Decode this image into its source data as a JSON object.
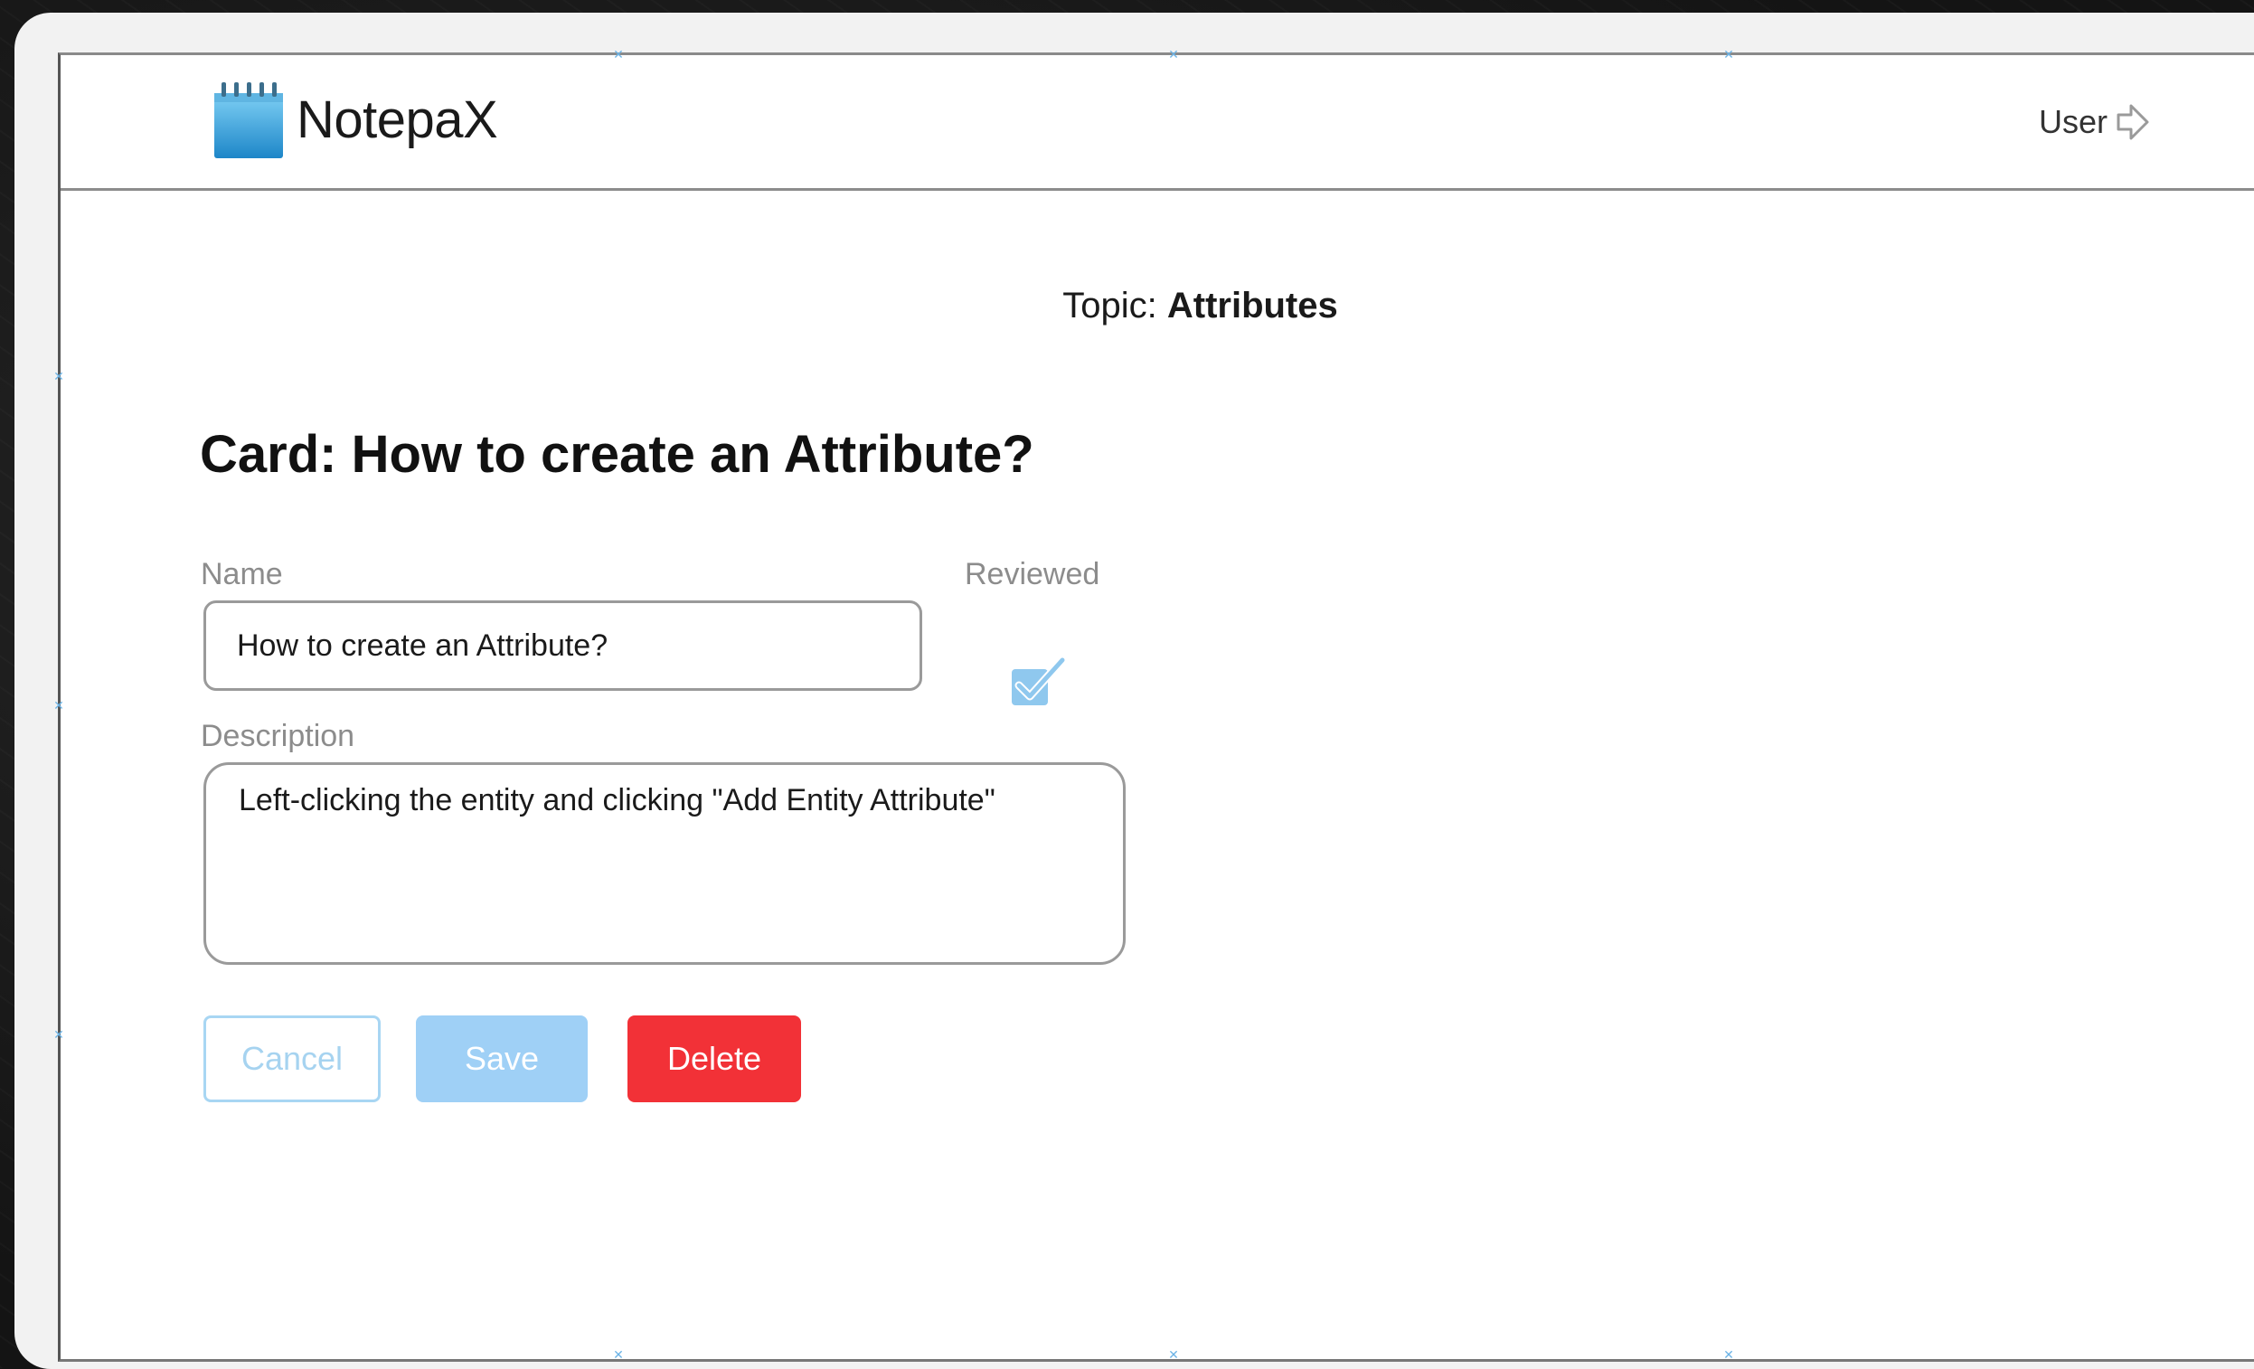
{
  "app": {
    "name": "NotepaX",
    "user_label": "User"
  },
  "topic": {
    "prefix": "Topic:",
    "value": "Attributes"
  },
  "card": {
    "title": "Card: How to create an Attribute?"
  },
  "form": {
    "name_label": "Name",
    "name_value": "How to create an Attribute?",
    "reviewed_label": "Reviewed",
    "reviewed_checked": true,
    "description_label": "Description",
    "description_value": "Left-clicking the entity and clicking \"Add Entity Attribute\""
  },
  "buttons": {
    "cancel": "Cancel",
    "save": "Save",
    "delete": "Delete"
  },
  "colors": {
    "accent": "#9fd0f6",
    "danger": "#f23137",
    "checkbox": "#8fc8ee"
  },
  "icons": {
    "logo": "notepad-icon",
    "user": "arrow-right-outline-icon",
    "reviewed": "checkbox-checked-icon"
  }
}
